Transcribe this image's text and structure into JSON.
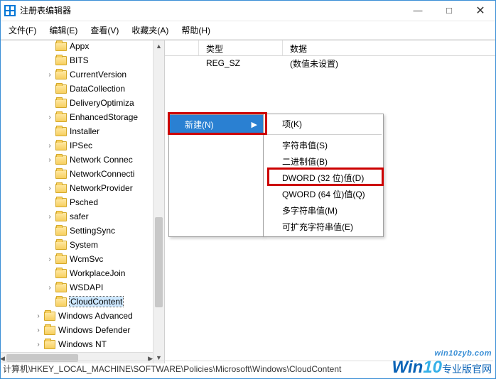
{
  "window": {
    "title": "注册表编辑器"
  },
  "win_controls": {
    "min": "—",
    "max": "□",
    "close": "✕"
  },
  "menubar": [
    {
      "label": "文件(F)"
    },
    {
      "label": "编辑(E)"
    },
    {
      "label": "查看(V)"
    },
    {
      "label": "收藏夹(A)"
    },
    {
      "label": "帮助(H)"
    }
  ],
  "tree": {
    "items": [
      {
        "indent": 4,
        "tw": "none",
        "label": "Appx"
      },
      {
        "indent": 4,
        "tw": "none",
        "label": "BITS"
      },
      {
        "indent": 4,
        "tw": "closed",
        "label": "CurrentVersion"
      },
      {
        "indent": 4,
        "tw": "none",
        "label": "DataCollection"
      },
      {
        "indent": 4,
        "tw": "none",
        "label": "DeliveryOptimiza"
      },
      {
        "indent": 4,
        "tw": "closed",
        "label": "EnhancedStorage"
      },
      {
        "indent": 4,
        "tw": "none",
        "label": "Installer"
      },
      {
        "indent": 4,
        "tw": "closed",
        "label": "IPSec"
      },
      {
        "indent": 4,
        "tw": "closed",
        "label": "Network Connec"
      },
      {
        "indent": 4,
        "tw": "none",
        "label": "NetworkConnecti"
      },
      {
        "indent": 4,
        "tw": "closed",
        "label": "NetworkProvider"
      },
      {
        "indent": 4,
        "tw": "none",
        "label": "Psched"
      },
      {
        "indent": 4,
        "tw": "closed",
        "label": "safer"
      },
      {
        "indent": 4,
        "tw": "none",
        "label": "SettingSync"
      },
      {
        "indent": 4,
        "tw": "none",
        "label": "System"
      },
      {
        "indent": 4,
        "tw": "closed",
        "label": "WcmSvc"
      },
      {
        "indent": 4,
        "tw": "none",
        "label": "WorkplaceJoin"
      },
      {
        "indent": 4,
        "tw": "closed",
        "label": "WSDAPI"
      },
      {
        "indent": 4,
        "tw": "none",
        "label": "CloudContent",
        "selected": true
      },
      {
        "indent": 3,
        "tw": "closed",
        "label": "Windows Advanced"
      },
      {
        "indent": 3,
        "tw": "closed",
        "label": "Windows Defender"
      },
      {
        "indent": 3,
        "tw": "closed",
        "label": "Windows NT"
      }
    ]
  },
  "list": {
    "headers": {
      "type": "类型",
      "data": "数据"
    },
    "rows": [
      {
        "type": "REG_SZ",
        "data": "(数值未设置)"
      }
    ]
  },
  "context_menu": {
    "parent": {
      "label": "新建(N)",
      "arrow": "▶"
    },
    "sub": [
      {
        "kind": "item",
        "label": "项(K)"
      },
      {
        "kind": "sep"
      },
      {
        "kind": "item",
        "label": "字符串值(S)"
      },
      {
        "kind": "item",
        "label": "二进制值(B)"
      },
      {
        "kind": "item",
        "label": "DWORD (32 位)值(D)",
        "highlight": true
      },
      {
        "kind": "item",
        "label": "QWORD (64 位)值(Q)"
      },
      {
        "kind": "item",
        "label": "多字符串值(M)"
      },
      {
        "kind": "item",
        "label": "可扩充字符串值(E)"
      }
    ]
  },
  "statusbar": {
    "path": "计算机\\HKEY_LOCAL_MACHINE\\SOFTWARE\\Policies\\Microsoft\\Windows\\CloudContent"
  },
  "watermark": {
    "small": "win10zyb.com",
    "big1": "Win",
    "big2": "10",
    "big3": "专业版官网"
  }
}
